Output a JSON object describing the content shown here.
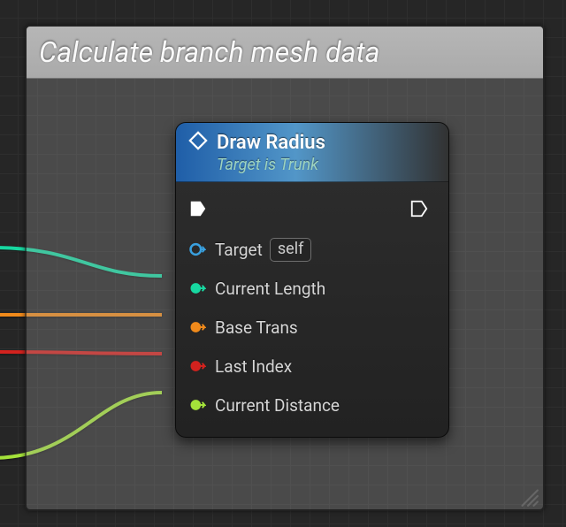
{
  "comment": {
    "title": "Calculate branch mesh data"
  },
  "node": {
    "title": "Draw Radius",
    "subtitle": "Target is Trunk",
    "inputs": [
      {
        "key": "target",
        "label": "Target",
        "color": "#39a0df",
        "filled": false,
        "default_value": "self"
      },
      {
        "key": "currentLength",
        "label": "Current Length",
        "color": "#17d8a1",
        "filled": true
      },
      {
        "key": "baseTrans",
        "label": "Base Trans",
        "color": "#f08a1b",
        "filled": true
      },
      {
        "key": "lastIndex",
        "label": "Last Index",
        "color": "#d3221e",
        "filled": true
      },
      {
        "key": "currentDistance",
        "label": "Current Distance",
        "color": "#a4e23a",
        "filled": true
      }
    ]
  },
  "wire_colors": {
    "currentLength": "#17d8a1",
    "baseTrans": "#f08a1b",
    "lastIndex": "#d3221e",
    "currentDistance": "#a4e23a"
  }
}
